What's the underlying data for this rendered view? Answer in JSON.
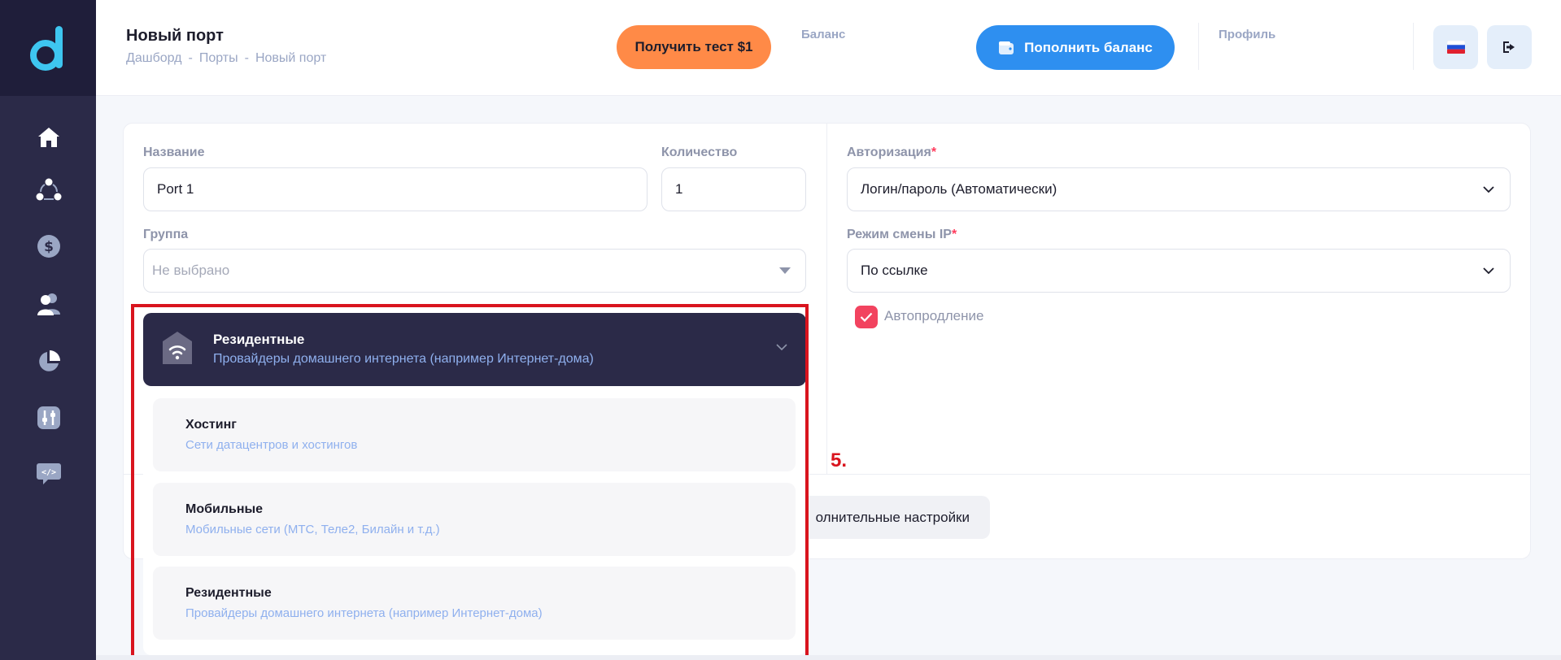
{
  "colors": {
    "sidebar": "#2b2a48",
    "accent_orange": "#ff8a47",
    "accent_blue": "#2e8ff0",
    "checkbox_red": "#f2435f",
    "highlight_red": "#d9141e"
  },
  "sidebar": {
    "logo_icon": "logo-d-icon",
    "items": [
      {
        "icon": "home-icon"
      },
      {
        "icon": "network-icon"
      },
      {
        "icon": "dollar-icon"
      },
      {
        "icon": "users-icon"
      },
      {
        "icon": "pie-chart-icon"
      },
      {
        "icon": "sliders-icon"
      },
      {
        "icon": "code-icon"
      }
    ]
  },
  "header": {
    "title": "Новый порт",
    "breadcrumb": [
      "Дашборд",
      "-",
      "Порты",
      "-",
      "Новый порт"
    ],
    "test_button": "Получить тест $1",
    "balance_label": "Баланс",
    "topup_button": "Пополнить баланс",
    "profile_label": "Профиль"
  },
  "form": {
    "name_label": "Название",
    "name_value": "Port 1",
    "qty_label": "Количество",
    "qty_value": "1",
    "group_label": "Группа",
    "group_placeholder": "Не выбрано",
    "auth_label": "Авторизация",
    "auth_required": "*",
    "auth_value": "Логин/пароль (Автоматически)",
    "ipmode_label": "Режим смены IP",
    "ipmode_required": "*",
    "ipmode_value": "По ссылке",
    "autorenew_label": "Автопродление",
    "autorenew_checked": true,
    "extra_settings_button": "олнительные настройки"
  },
  "dropdown": {
    "selected_title": "Резидентные",
    "selected_subtitle": "Провайдеры домашнего интернета (например Интернет-дома)",
    "options": [
      {
        "title": "Хостинг",
        "subtitle": "Сети датацентров и хостингов"
      },
      {
        "title": "Мобильные",
        "subtitle": "Мобильные сети (МТС, Теле2, Билайн и т.д.)"
      },
      {
        "title": "Резидентные",
        "subtitle": "Провайдеры домашнего интернета (например Интернет-дома)"
      }
    ]
  },
  "annotation": {
    "step": "5."
  }
}
